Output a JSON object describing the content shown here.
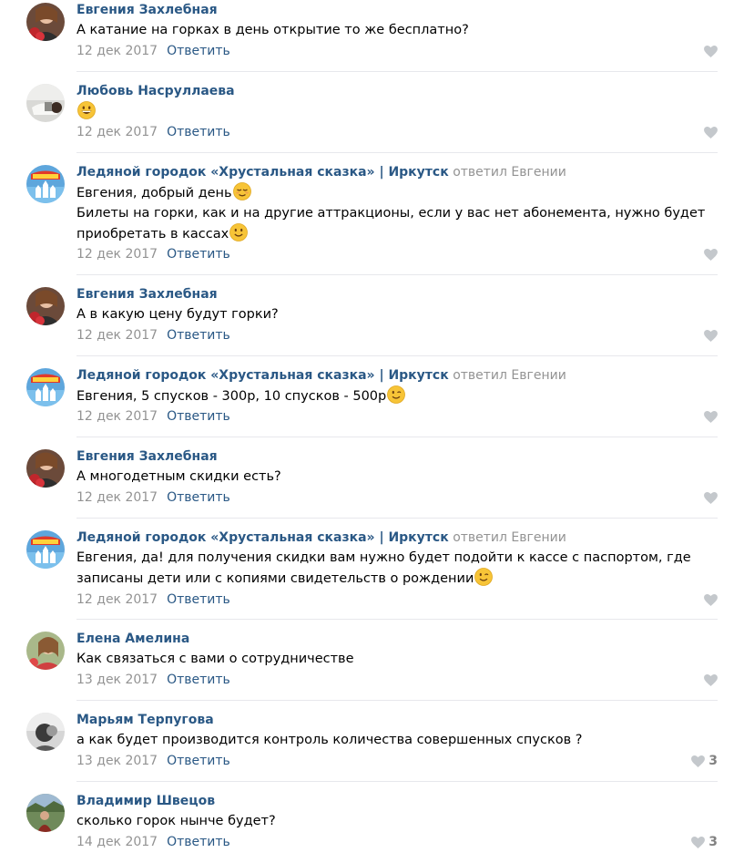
{
  "comments": [
    {
      "author": "Евгения Захлебная",
      "reply_to": "",
      "lines": [
        "А катание на горках в день открытие то же бесплатно?"
      ],
      "emoji": "",
      "date": "12 дек 2017",
      "reply_label": "Ответить",
      "likes": "",
      "avatar": "woman-with-roses"
    },
    {
      "author": "Любовь Насруллаева",
      "reply_to": "",
      "lines": [
        ""
      ],
      "emoji": "grinning-face",
      "date": "12 дек 2017",
      "reply_label": "Ответить",
      "likes": "",
      "avatar": "blurred-photo"
    },
    {
      "author": "Ледяной городок «Хрустальная сказка» | Иркутск",
      "reply_to": "ответил Евгении",
      "lines": [
        "Евгения, добрый день",
        "Билеты на горки, как и на другие аттракционы, если у вас нет абонемента, нужно будет",
        "приобретать в кассах"
      ],
      "emoji": "",
      "date": "12 дек 2017",
      "reply_label": "Ответить",
      "likes": "",
      "avatar": "ice-town-logo"
    },
    {
      "author": "Евгения Захлебная",
      "reply_to": "",
      "lines": [
        "А в какую цену будут горки?"
      ],
      "emoji": "",
      "date": "12 дек 2017",
      "reply_label": "Ответить",
      "likes": "",
      "avatar": "woman-with-roses"
    },
    {
      "author": "Ледяной городок «Хрустальная сказка» | Иркутск",
      "reply_to": "ответил Евгении",
      "lines": [
        "Евгения, 5 спусков - 300р, 10 спусков - 500р"
      ],
      "emoji": "winking-face",
      "date": "12 дек 2017",
      "reply_label": "Ответить",
      "likes": "",
      "avatar": "ice-town-logo"
    },
    {
      "author": "Евгения Захлебная",
      "reply_to": "",
      "lines": [
        "А многодетным скидки есть?"
      ],
      "emoji": "",
      "date": "12 дек 2017",
      "reply_label": "Ответить",
      "likes": "",
      "avatar": "woman-with-roses"
    },
    {
      "author": "Ледяной городок «Хрустальная сказка» | Иркутск",
      "reply_to": "ответил Евгении",
      "lines": [
        "Евгения, да! для получения скидки вам нужно будет подойти к кассе с паспортом, где",
        "записаны дети или с копиями свидетельств о рождении"
      ],
      "emoji": "winking-face",
      "date": "12 дек 2017",
      "reply_label": "Ответить",
      "likes": "",
      "avatar": "ice-town-logo"
    },
    {
      "author": "Елена Амелина",
      "reply_to": "",
      "lines": [
        "Как связаться с вами о сотрудничестве"
      ],
      "emoji": "",
      "date": "13 дек 2017",
      "reply_label": "Ответить",
      "likes": "",
      "avatar": "woman-portrait"
    },
    {
      "author": "Марьям Терпугова",
      "reply_to": "",
      "lines": [
        "а как будет производится контроль количества совершенных спусков ?"
      ],
      "emoji": "",
      "date": "13 дек 2017",
      "reply_label": "Ответить",
      "likes": "3",
      "avatar": "bw-portrait"
    },
    {
      "author": "Владимир Швецов",
      "reply_to": "",
      "lines": [
        "сколько горок нынче будет?"
      ],
      "emoji": "",
      "date": "14 дек 2017",
      "reply_label": "Ответить",
      "likes": "3",
      "avatar": "outdoor-photo"
    }
  ],
  "colors": {
    "link": "#2a5885",
    "muted": "#939393",
    "divider": "#e7e8ec",
    "heart": "#c4c8cc"
  }
}
